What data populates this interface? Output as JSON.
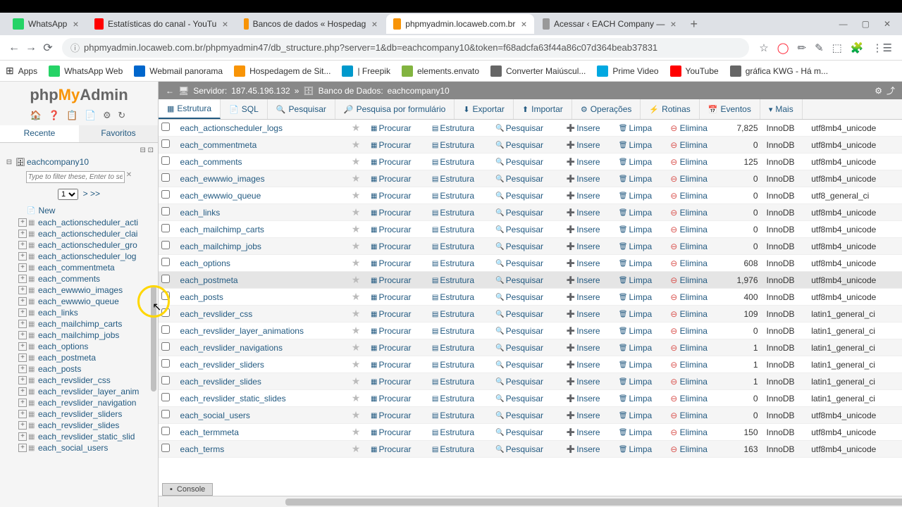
{
  "browser": {
    "tabs": [
      {
        "title": "WhatsApp",
        "icon_bg": "#25d366"
      },
      {
        "title": "Estatísticas do canal - YouTu",
        "icon_bg": "#ff0000"
      },
      {
        "title": "Bancos de dados « Hospedag",
        "icon_bg": "#f89406"
      },
      {
        "title": "phpmyadmin.locaweb.com.br",
        "icon_bg": "#f89406",
        "active": true
      },
      {
        "title": "Acessar ‹ EACH Company —",
        "icon_bg": "#999"
      }
    ],
    "url": "phpmyadmin.locaweb.com.br/phpmyadmin47/db_structure.php?server=1&db=eachcompany10&token=f68adcfa63f44a86c07d364beab37831",
    "bookmarks": [
      {
        "label": "Apps",
        "color": "#666"
      },
      {
        "label": "WhatsApp Web",
        "color": "#25d366"
      },
      {
        "label": "Webmail panorama",
        "color": "#0066cc"
      },
      {
        "label": "Hospedagem de Sit...",
        "color": "#f89406"
      },
      {
        "label": "| Freepik",
        "color": "#0099cc"
      },
      {
        "label": "elements.envato",
        "color": "#82b440"
      },
      {
        "label": "Converter Maiúscul...",
        "color": "#666"
      },
      {
        "label": "Prime Video",
        "color": "#00a8e1"
      },
      {
        "label": "YouTube",
        "color": "#ff0000"
      },
      {
        "label": "gráfica KWG - Há m...",
        "color": "#666"
      }
    ]
  },
  "sidebar": {
    "recent": "Recente",
    "favorites": "Favoritos",
    "filter_placeholder": "Type to filter these, Enter to search",
    "page_next": "> >>",
    "db_name": "eachcompany10",
    "new_label": "New",
    "tables": [
      "each_actionscheduler_acti",
      "each_actionscheduler_clai",
      "each_actionscheduler_gro",
      "each_actionscheduler_log",
      "each_commentmeta",
      "each_comments",
      "each_ewwwio_images",
      "each_ewwwio_queue",
      "each_links",
      "each_mailchimp_carts",
      "each_mailchimp_jobs",
      "each_options",
      "each_postmeta",
      "each_posts",
      "each_revslider_css",
      "each_revslider_layer_anim",
      "each_revslider_navigation",
      "each_revslider_sliders",
      "each_revslider_slides",
      "each_revslider_static_slid",
      "each_social_users"
    ]
  },
  "breadcrumb": {
    "server_label": "Servidor:",
    "server_value": "187.45.196.132",
    "db_label": "Banco de Dados:",
    "db_value": "eachcompany10"
  },
  "tabs": {
    "items": [
      "Estrutura",
      "SQL",
      "Pesquisar",
      "Pesquisa por formulário",
      "Exportar",
      "Importar",
      "Operações",
      "Rotinas",
      "Eventos",
      "Mais"
    ],
    "active": 0
  },
  "actions": {
    "browse": "Procurar",
    "structure": "Estrutura",
    "search": "Pesquisar",
    "insert": "Insere",
    "empty": "Limpa",
    "drop": "Elimina"
  },
  "table_list": [
    {
      "name": "each_actionscheduler_logs",
      "rows": "7,825",
      "engine": "InnoDB",
      "collation": "utf8mb4_unicode"
    },
    {
      "name": "each_commentmeta",
      "rows": "0",
      "engine": "InnoDB",
      "collation": "utf8mb4_unicode"
    },
    {
      "name": "each_comments",
      "rows": "125",
      "engine": "InnoDB",
      "collation": "utf8mb4_unicode"
    },
    {
      "name": "each_ewwwio_images",
      "rows": "0",
      "engine": "InnoDB",
      "collation": "utf8mb4_unicode"
    },
    {
      "name": "each_ewwwio_queue",
      "rows": "0",
      "engine": "InnoDB",
      "collation": "utf8_general_ci"
    },
    {
      "name": "each_links",
      "rows": "0",
      "engine": "InnoDB",
      "collation": "utf8mb4_unicode"
    },
    {
      "name": "each_mailchimp_carts",
      "rows": "0",
      "engine": "InnoDB",
      "collation": "utf8mb4_unicode"
    },
    {
      "name": "each_mailchimp_jobs",
      "rows": "0",
      "engine": "InnoDB",
      "collation": "utf8mb4_unicode"
    },
    {
      "name": "each_options",
      "rows": "608",
      "engine": "InnoDB",
      "collation": "utf8mb4_unicode"
    },
    {
      "name": "each_postmeta",
      "rows": "1,976",
      "engine": "InnoDB",
      "collation": "utf8mb4_unicode",
      "highlight": true
    },
    {
      "name": "each_posts",
      "rows": "400",
      "engine": "InnoDB",
      "collation": "utf8mb4_unicode"
    },
    {
      "name": "each_revslider_css",
      "rows": "109",
      "engine": "InnoDB",
      "collation": "latin1_general_ci"
    },
    {
      "name": "each_revslider_layer_animations",
      "rows": "0",
      "engine": "InnoDB",
      "collation": "latin1_general_ci"
    },
    {
      "name": "each_revslider_navigations",
      "rows": "1",
      "engine": "InnoDB",
      "collation": "latin1_general_ci"
    },
    {
      "name": "each_revslider_sliders",
      "rows": "1",
      "engine": "InnoDB",
      "collation": "latin1_general_ci"
    },
    {
      "name": "each_revslider_slides",
      "rows": "1",
      "engine": "InnoDB",
      "collation": "latin1_general_ci"
    },
    {
      "name": "each_revslider_static_slides",
      "rows": "0",
      "engine": "InnoDB",
      "collation": "latin1_general_ci"
    },
    {
      "name": "each_social_users",
      "rows": "0",
      "engine": "InnoDB",
      "collation": "utf8mb4_unicode"
    },
    {
      "name": "each_termmeta",
      "rows": "150",
      "engine": "InnoDB",
      "collation": "utf8mb4_unicode"
    },
    {
      "name": "each_terms",
      "rows": "163",
      "engine": "InnoDB",
      "collation": "utf8mb4_unicode"
    }
  ],
  "console_label": "Console"
}
